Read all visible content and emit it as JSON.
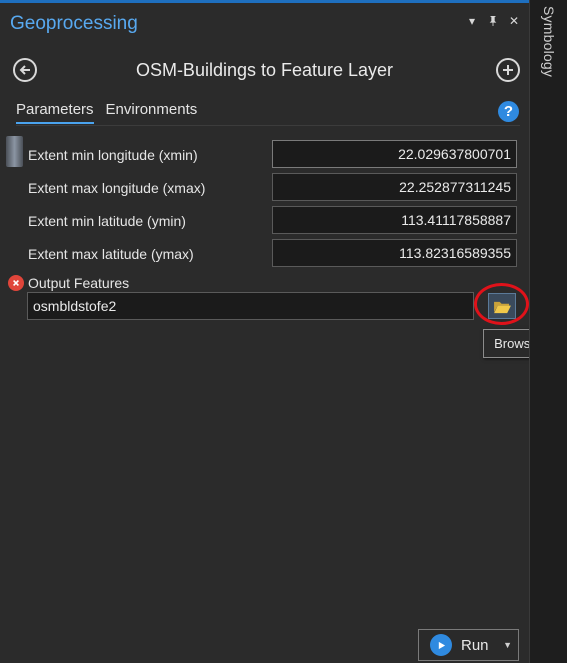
{
  "pane": {
    "title": "Geoprocessing",
    "controls": {
      "options_icon": "▾",
      "pin_icon": "pin",
      "close_icon": "✕"
    }
  },
  "side_tab": {
    "label": "Symbology"
  },
  "tool": {
    "title": "OSM-Buildings to Feature Layer"
  },
  "tabs": [
    {
      "label": "Parameters",
      "active": true
    },
    {
      "label": "Environments",
      "active": false
    }
  ],
  "params": [
    {
      "label": "Extent min longitude (xmin)",
      "value": "22.029637800701"
    },
    {
      "label": "Extent max longitude (xmax)",
      "value": "22.252877311245"
    },
    {
      "label": "Extent min latitude (ymin)",
      "value": "113.41117858887"
    },
    {
      "label": "Extent max latitude (ymax)",
      "value": "113.82316589355"
    }
  ],
  "output": {
    "label": "Output Features",
    "value": "osmbldstofe2",
    "status": "error"
  },
  "tooltip": {
    "text": "Browse...."
  },
  "run": {
    "label": "Run"
  },
  "colors": {
    "accent": "#1e6fbf",
    "title_blue": "#58a9f0",
    "error": "#e0453a",
    "highlight": "#e0121a"
  }
}
